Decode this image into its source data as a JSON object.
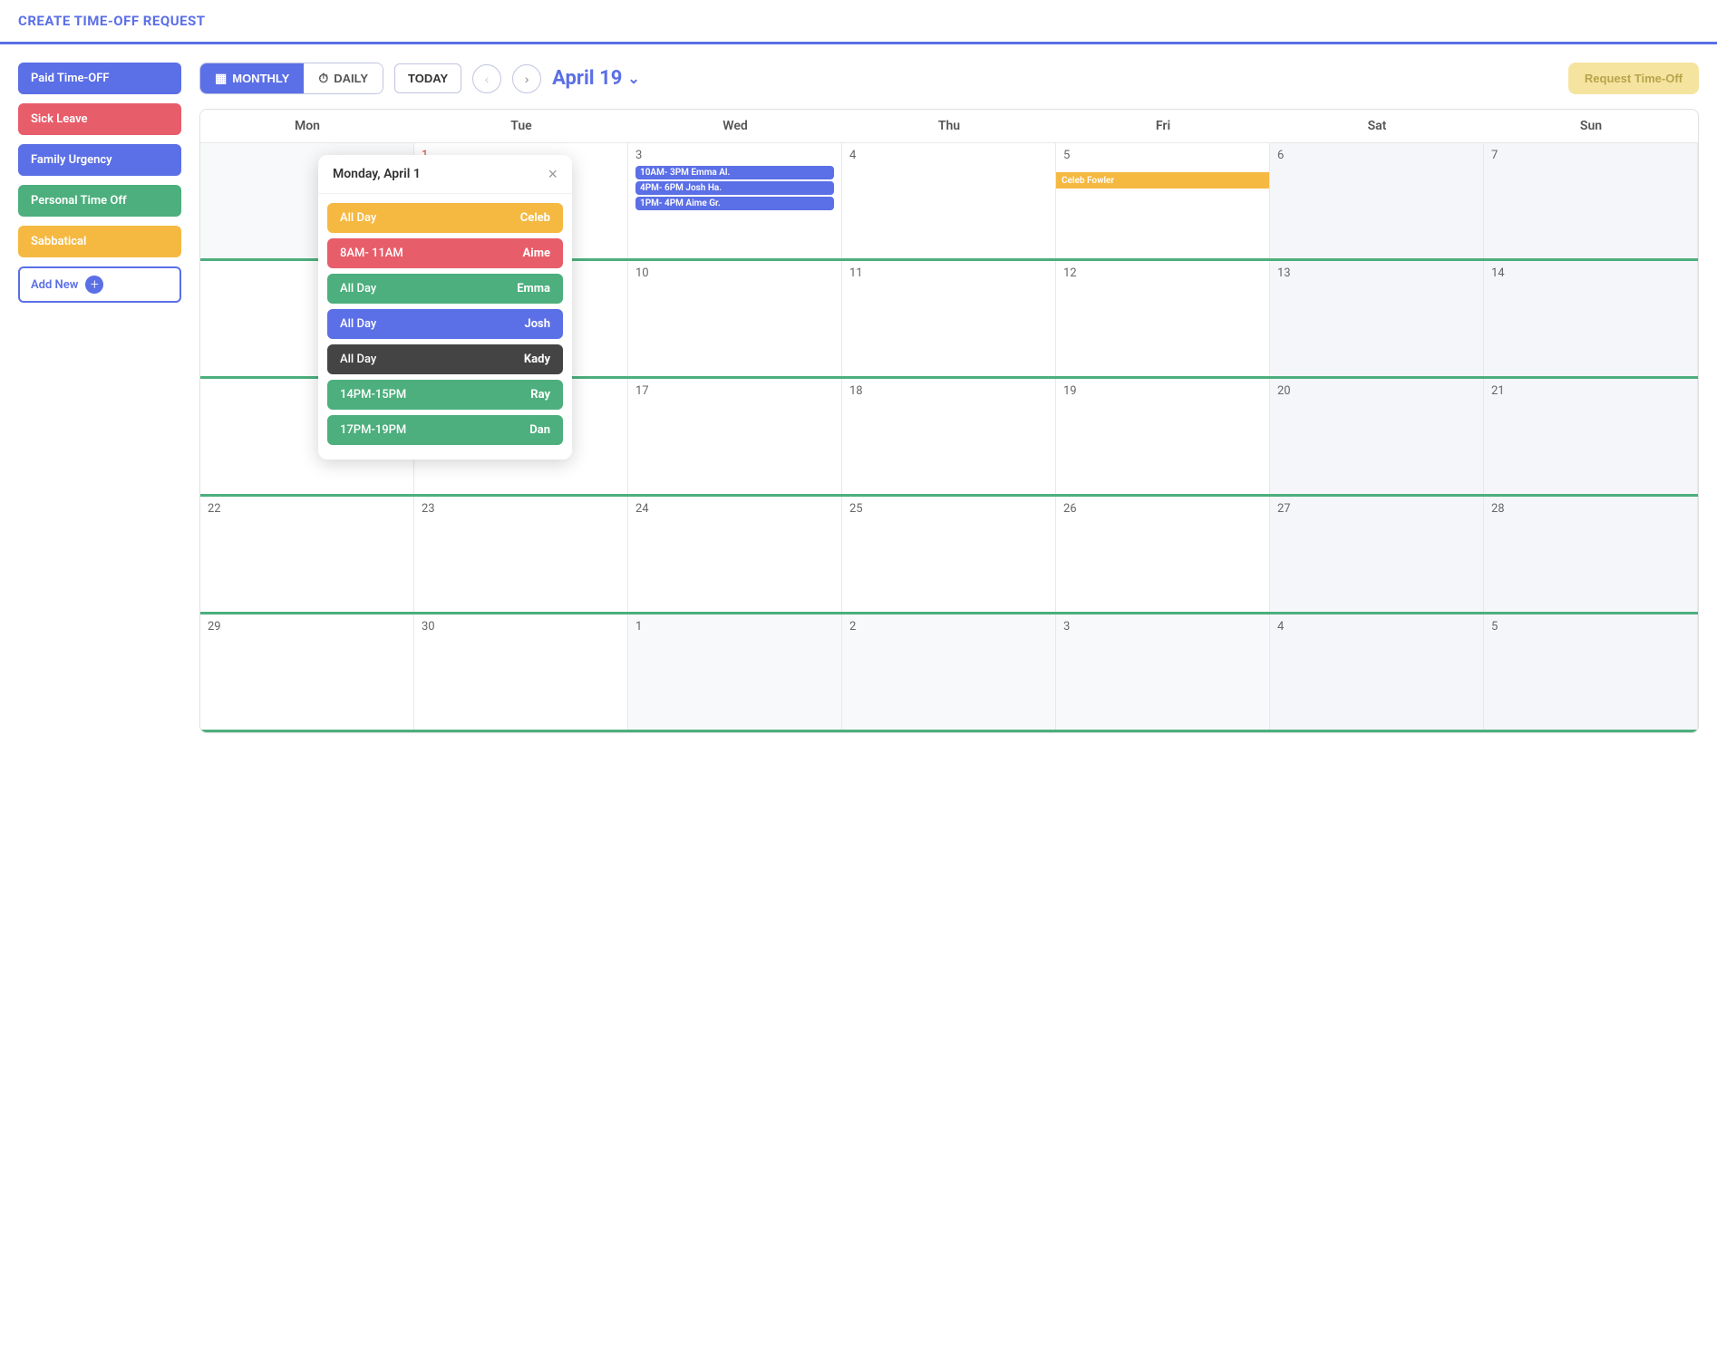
{
  "header": {
    "title": "CREATE TIME-OFF REQUEST"
  },
  "sidebar": {
    "items": [
      {
        "key": "paid",
        "label": "Paid Time-OFF",
        "class": "paid"
      },
      {
        "key": "sick",
        "label": "Sick Leave",
        "class": "sick"
      },
      {
        "key": "family",
        "label": "Family Urgency",
        "class": "family"
      },
      {
        "key": "personal",
        "label": "Personal Time Off",
        "class": "personal"
      },
      {
        "key": "sabbatical",
        "label": "Sabbatical",
        "class": "sabbatical"
      }
    ],
    "add_new_label": "Add New"
  },
  "toolbar": {
    "monthly_label": "MONTHLY",
    "daily_label": "DAILY",
    "today_label": "TODAY",
    "month_title": "April 19",
    "request_btn": "Request Time-Off"
  },
  "day_headers": [
    "Mon",
    "Tue",
    "Wed",
    "Thu",
    "Fri",
    "Sat",
    "Sun"
  ],
  "popup": {
    "title": "Monday, April 1",
    "items": [
      {
        "time": "All Day",
        "name": "Celeb",
        "class": "yellow"
      },
      {
        "time": "8AM- 11AM",
        "name": "Aime",
        "class": "pink"
      },
      {
        "time": "All Day",
        "name": "Emma",
        "class": "green"
      },
      {
        "time": "All Day",
        "name": "Josh",
        "class": "blue"
      },
      {
        "time": "All Day",
        "name": "Kady",
        "class": "dark"
      },
      {
        "time": "14PM-15PM",
        "name": "Ray",
        "class": "green"
      },
      {
        "time": "17PM-19PM",
        "name": "Dan",
        "class": "green"
      }
    ]
  },
  "calendar": {
    "weeks": [
      {
        "days": [
          {
            "num": "",
            "class": "other-month",
            "col": "mon"
          },
          {
            "num": "1",
            "class": "",
            "col": "tue",
            "has_popup": true
          },
          {
            "num": "3",
            "class": "",
            "col": "wed",
            "events": [
              {
                "text": "10AM- 3PM Emma Al.",
                "class": "blue"
              },
              {
                "text": "4PM- 6PM  Josh Ha.",
                "class": "blue"
              },
              {
                "text": "1PM- 4PM  Aime Gr.",
                "class": "blue"
              }
            ]
          },
          {
            "num": "4",
            "class": "",
            "col": "thu"
          },
          {
            "num": "5",
            "class": "",
            "col": "fri",
            "events": [
              {
                "text": "Celeb Fowler",
                "class": "yellow",
                "bar": true
              }
            ]
          },
          {
            "num": "6",
            "class": "sat",
            "col": "sat"
          },
          {
            "num": "7",
            "class": "sun",
            "col": "sun"
          }
        ]
      },
      {
        "days": [
          {
            "num": "",
            "col": "mon"
          },
          {
            "num": "",
            "col": "tue"
          },
          {
            "num": "10",
            "col": "wed"
          },
          {
            "num": "11",
            "col": "thu"
          },
          {
            "num": "12",
            "col": "fri"
          },
          {
            "num": "13",
            "col": "sat",
            "class": "sat"
          },
          {
            "num": "14",
            "col": "sun",
            "class": "sun"
          }
        ]
      },
      {
        "days": [
          {
            "num": "",
            "col": "mon"
          },
          {
            "num": "",
            "col": "tue"
          },
          {
            "num": "17",
            "col": "wed"
          },
          {
            "num": "18",
            "col": "thu"
          },
          {
            "num": "19",
            "col": "fri"
          },
          {
            "num": "20",
            "col": "sat",
            "class": "sat"
          },
          {
            "num": "21",
            "col": "sun",
            "class": "sun"
          }
        ]
      },
      {
        "days": [
          {
            "num": "22",
            "col": "mon"
          },
          {
            "num": "23",
            "col": "tue"
          },
          {
            "num": "24",
            "col": "wed"
          },
          {
            "num": "25",
            "col": "thu"
          },
          {
            "num": "26",
            "col": "fri"
          },
          {
            "num": "27",
            "col": "sat",
            "class": "sat"
          },
          {
            "num": "28",
            "col": "sun",
            "class": "sun"
          }
        ]
      },
      {
        "days": [
          {
            "num": "29",
            "col": "mon"
          },
          {
            "num": "30",
            "col": "tue"
          },
          {
            "num": "1",
            "col": "wed",
            "class": "other-month"
          },
          {
            "num": "2",
            "col": "thu",
            "class": "other-month"
          },
          {
            "num": "3",
            "col": "fri",
            "class": "other-month"
          },
          {
            "num": "4",
            "col": "sat",
            "class": "sat other-month"
          },
          {
            "num": "5",
            "col": "sun",
            "class": "sun other-month"
          }
        ]
      }
    ]
  }
}
